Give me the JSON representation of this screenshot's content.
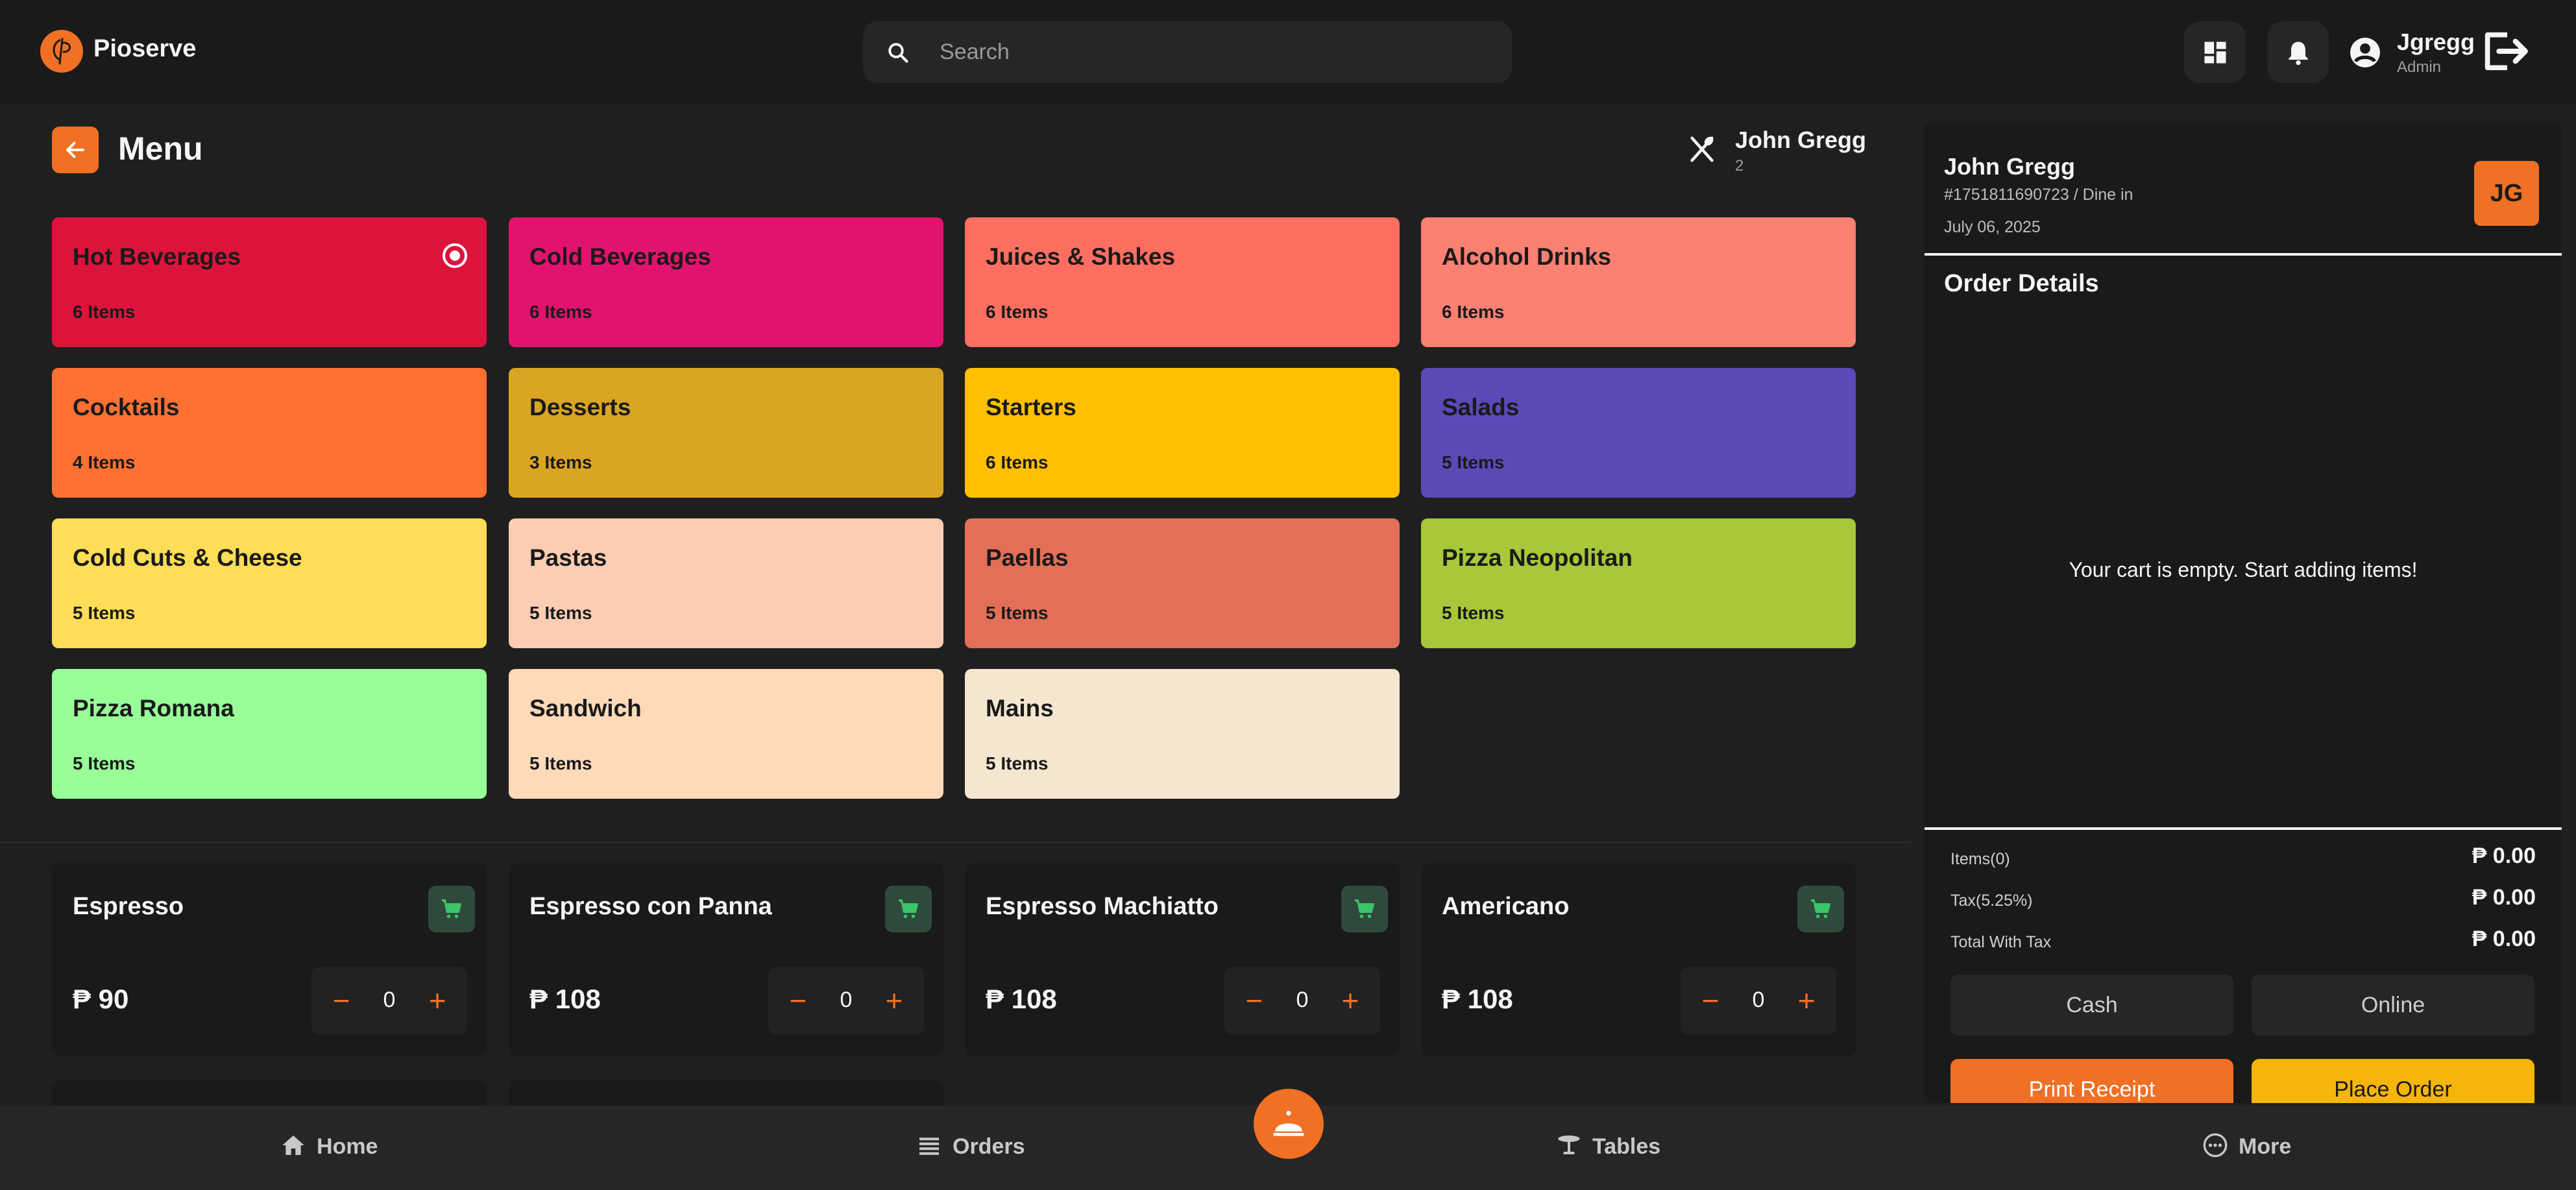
{
  "header": {
    "brand": "Pioserve",
    "search_placeholder": "Search",
    "user_name": "Jgregg",
    "user_role": "Admin"
  },
  "menu": {
    "title": "Menu",
    "customer_name": "John Gregg",
    "guests": "2"
  },
  "categories": [
    {
      "name": "Hot Beverages",
      "count": "6 Items",
      "color": "#dc143c",
      "selected": true
    },
    {
      "name": "Cold Beverages",
      "count": "6 Items",
      "color": "#e2136e"
    },
    {
      "name": "Juices & Shakes",
      "count": "6 Items",
      "color": "#ff6f61"
    },
    {
      "name": "Alcohol Drinks",
      "count": "6 Items",
      "color": "#fa8072"
    },
    {
      "name": "Cocktails",
      "count": "4 Items",
      "color": "#ff7133"
    },
    {
      "name": "Desserts",
      "count": "3 Items",
      "color": "#daa520"
    },
    {
      "name": "Starters",
      "count": "6 Items",
      "color": "#ffc000"
    },
    {
      "name": "Salads",
      "count": "5 Items",
      "color": "#5b49b7"
    },
    {
      "name": "Cold Cuts & Cheese",
      "count": "5 Items",
      "color": "#ffdd57"
    },
    {
      "name": "Pastas",
      "count": "5 Items",
      "color": "#fdcdb3"
    },
    {
      "name": "Paellas",
      "count": "5 Items",
      "color": "#e27058"
    },
    {
      "name": "Pizza Neopolitan",
      "count": "5 Items",
      "color": "#a6c83a"
    },
    {
      "name": "Pizza Romana",
      "count": "5 Items",
      "color": "#98ff98"
    },
    {
      "name": "Sandwich",
      "count": "5 Items",
      "color": "#ffdab9"
    },
    {
      "name": "Mains",
      "count": "5 Items",
      "color": "#f5e6d0"
    }
  ],
  "items": [
    {
      "name": "Espresso",
      "price": "₱ 90",
      "qty": "0"
    },
    {
      "name": "Espresso con Panna",
      "price": "₱ 108",
      "qty": "0"
    },
    {
      "name": "Espresso Machiatto",
      "price": "₱ 108",
      "qty": "0"
    },
    {
      "name": "Americano",
      "price": "₱ 108",
      "qty": "0"
    }
  ],
  "qty_controls": {
    "minus": "−",
    "plus": "+"
  },
  "order": {
    "customer_name": "John Gregg",
    "order_info": "#1751811690723 / Dine in",
    "date": "July 06, 2025",
    "avatar": "JG",
    "details_title": "Order Details",
    "empty_message": "Your cart is empty. Start adding items!",
    "items_label": "Items(0)",
    "items_value": "₱ 0.00",
    "tax_label": "Tax(5.25%)",
    "tax_value": "₱ 0.00",
    "total_label": "Total With Tax",
    "total_value": "₱ 0.00",
    "cash_label": "Cash",
    "online_label": "Online",
    "print_label": "Print Receipt",
    "place_label": "Place Order"
  },
  "nav": {
    "home": "Home",
    "orders": "Orders",
    "tables": "Tables",
    "more": "More"
  },
  "colors": {
    "accent": "#f07024",
    "place_order": "#f5b50a",
    "cart_icon": "#3cc46a"
  },
  "icons": [
    "pioserve-logo-icon",
    "search-icon",
    "dashboard-icon",
    "bell-icon",
    "user-circle-icon",
    "logout-icon",
    "arrow-left-icon",
    "utensils-icon",
    "cart-icon",
    "home-icon",
    "list-icon",
    "cloche-icon",
    "table-icon",
    "more-icon"
  ]
}
